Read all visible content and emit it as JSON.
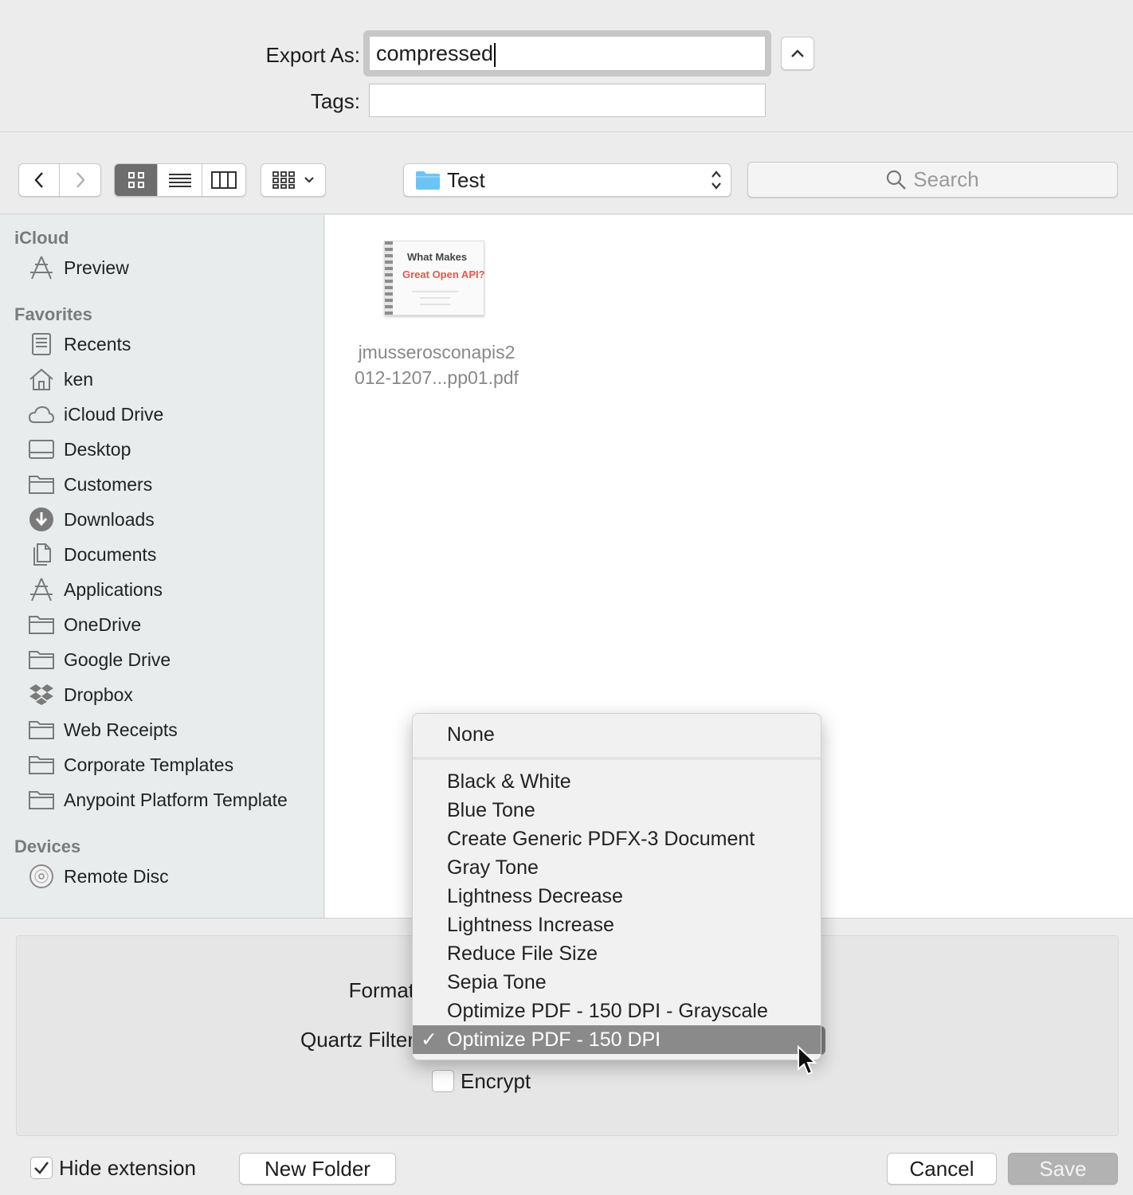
{
  "export": {
    "export_as_label": "Export As:",
    "export_as_value": "compressed",
    "tags_label": "Tags:",
    "tags_value": ""
  },
  "toolbar": {
    "location": "Test",
    "search_placeholder": "Search"
  },
  "sidebar": {
    "icloud_header": "iCloud",
    "icloud_items": [
      {
        "label": "Preview",
        "icon": "apps-icon"
      }
    ],
    "favorites_header": "Favorites",
    "favorites": [
      {
        "label": "Recents",
        "icon": "recents-icon"
      },
      {
        "label": "ken",
        "icon": "home-icon"
      },
      {
        "label": "iCloud Drive",
        "icon": "cloud-icon"
      },
      {
        "label": "Desktop",
        "icon": "desktop-icon"
      },
      {
        "label": "Customers",
        "icon": "folder-icon"
      },
      {
        "label": "Downloads",
        "icon": "download-icon"
      },
      {
        "label": "Documents",
        "icon": "documents-icon"
      },
      {
        "label": "Applications",
        "icon": "apps-icon"
      },
      {
        "label": "OneDrive",
        "icon": "folder-icon"
      },
      {
        "label": "Google Drive",
        "icon": "folder-icon"
      },
      {
        "label": "Dropbox",
        "icon": "dropbox-icon"
      },
      {
        "label": "Web Receipts",
        "icon": "folder-icon"
      },
      {
        "label": "Corporate Templates",
        "icon": "folder-icon"
      },
      {
        "label": "Anypoint Platform Template",
        "icon": "folder-icon"
      }
    ],
    "devices_header": "Devices",
    "devices": [
      {
        "label": "Remote Disc",
        "icon": "disc-icon"
      }
    ]
  },
  "file": {
    "thumb_line1": "What Makes",
    "thumb_line2": "Great Open API?",
    "name_line1": "jmusserosconapis2",
    "name_line2": "012-1207...pp01.pdf"
  },
  "options": {
    "format_label": "Format",
    "quartz_label": "Quartz Filter",
    "encrypt_label": "Encrypt",
    "encrypt_checked": false
  },
  "menu": {
    "first": "None",
    "items": [
      "Black & White",
      "Blue Tone",
      "Create Generic PDFX-3 Document",
      "Gray Tone",
      "Lightness Decrease",
      "Lightness Increase",
      "Reduce File Size",
      "Sepia Tone",
      "Optimize PDF - 150 DPI - Grayscale"
    ],
    "selected": "Optimize PDF - 150 DPI",
    "checkmark": "✓"
  },
  "footer": {
    "hide_extension_label": "Hide extension",
    "hide_extension_checked": true,
    "new_folder": "New Folder",
    "cancel": "Cancel",
    "save": "Save"
  },
  "colors": {
    "selected_menu_bg": "#8a8a8a",
    "folder_blue": "#6cc4f5",
    "thumb_red": "#e05a4e"
  }
}
